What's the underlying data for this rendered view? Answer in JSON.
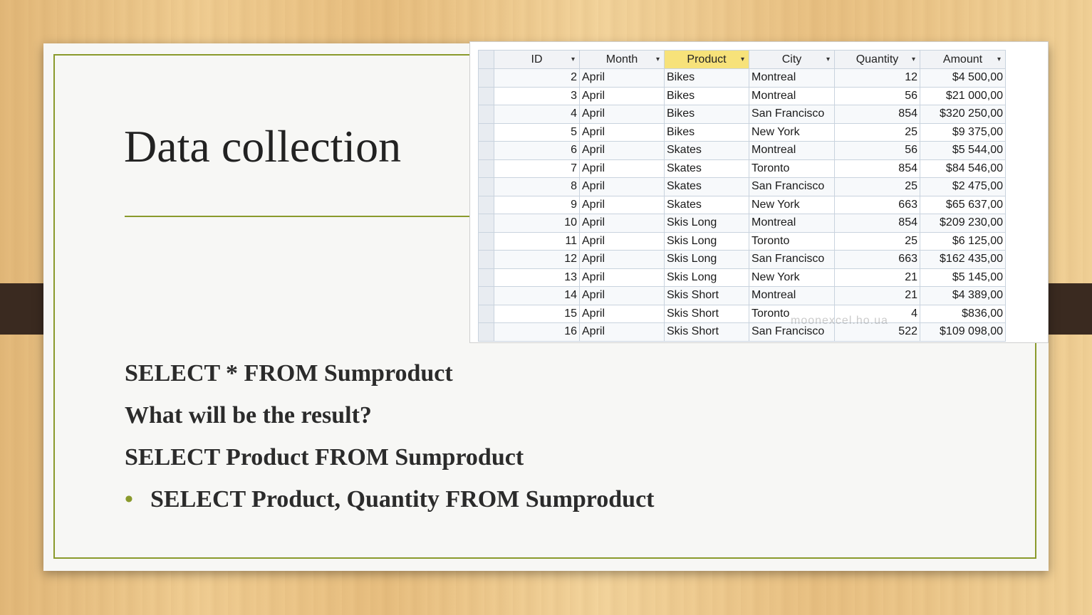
{
  "slide": {
    "title": "Data collection",
    "lines": [
      "SELECT * FROM Sumproduct",
      "What will be the result?",
      "SELECT Product FROM Sumproduct"
    ],
    "bullet": "SELECT Product, Quantity FROM Sumproduct",
    "bullet_symbol": "•",
    "accent_color": "#8a9a2c"
  },
  "table": {
    "columns": [
      "ID",
      "Month",
      "Product",
      "City",
      "Quantity",
      "Amount"
    ],
    "selected_column": "Product",
    "dropdown_symbol": "▾",
    "rows": [
      [
        "2",
        "April",
        "Bikes",
        "Montreal",
        "12",
        "$4 500,00"
      ],
      [
        "3",
        "April",
        "Bikes",
        "Montreal",
        "56",
        "$21 000,00"
      ],
      [
        "4",
        "April",
        "Bikes",
        "San Francisco",
        "854",
        "$320 250,00"
      ],
      [
        "5",
        "April",
        "Bikes",
        "New York",
        "25",
        "$9 375,00"
      ],
      [
        "6",
        "April",
        "Skates",
        "Montreal",
        "56",
        "$5 544,00"
      ],
      [
        "7",
        "April",
        "Skates",
        "Toronto",
        "854",
        "$84 546,00"
      ],
      [
        "8",
        "April",
        "Skates",
        "San Francisco",
        "25",
        "$2 475,00"
      ],
      [
        "9",
        "April",
        "Skates",
        "New York",
        "663",
        "$65 637,00"
      ],
      [
        "10",
        "April",
        "Skis Long",
        "Montreal",
        "854",
        "$209 230,00"
      ],
      [
        "11",
        "April",
        "Skis Long",
        "Toronto",
        "25",
        "$6 125,00"
      ],
      [
        "12",
        "April",
        "Skis Long",
        "San Francisco",
        "663",
        "$162 435,00"
      ],
      [
        "13",
        "April",
        "Skis Long",
        "New York",
        "21",
        "$5 145,00"
      ],
      [
        "14",
        "April",
        "Skis Short",
        "Montreal",
        "21",
        "$4 389,00"
      ],
      [
        "15",
        "April",
        "Skis Short",
        "Toronto",
        "4",
        "$836,00"
      ],
      [
        "16",
        "April",
        "Skis Short",
        "San Francisco",
        "522",
        "$109 098,00"
      ]
    ],
    "watermark": "moonexcel.ho.ua"
  }
}
